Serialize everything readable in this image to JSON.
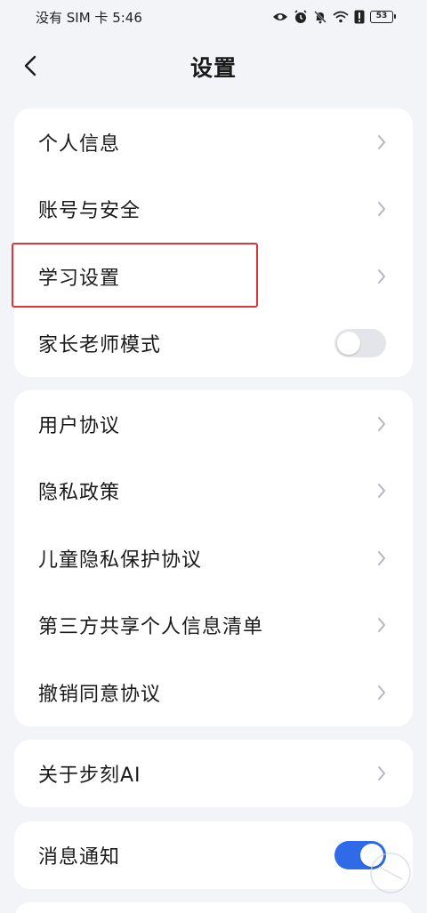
{
  "status_bar": {
    "carrier_time": "没有 SIM 卡 5:46",
    "battery": "53",
    "icons": [
      "eye-icon",
      "alarm-icon",
      "mute-icon",
      "wifi-icon",
      "alert-icon",
      "battery-icon"
    ]
  },
  "nav": {
    "title": "设置",
    "back_icon": "chevron-left-icon"
  },
  "group1": [
    {
      "label": "个人信息"
    },
    {
      "label": "账号与安全"
    },
    {
      "label": "学习设置"
    },
    {
      "label": "家长老师模式",
      "toggle": "off"
    }
  ],
  "group2": [
    {
      "label": "用户协议"
    },
    {
      "label": "隐私政策"
    },
    {
      "label": "儿童隐私保护协议"
    },
    {
      "label": "第三方共享个人信息清单"
    },
    {
      "label": "撤销同意协议"
    }
  ],
  "group3": [
    {
      "label": "关于步刻AI"
    }
  ],
  "group4": [
    {
      "label": "消息通知",
      "toggle": "on"
    }
  ],
  "colors": {
    "background": "#f3f4f8",
    "card": "#ffffff",
    "toggle_on": "#2f6be8",
    "toggle_off": "#e4e5ea",
    "highlight": "#d9373a"
  }
}
